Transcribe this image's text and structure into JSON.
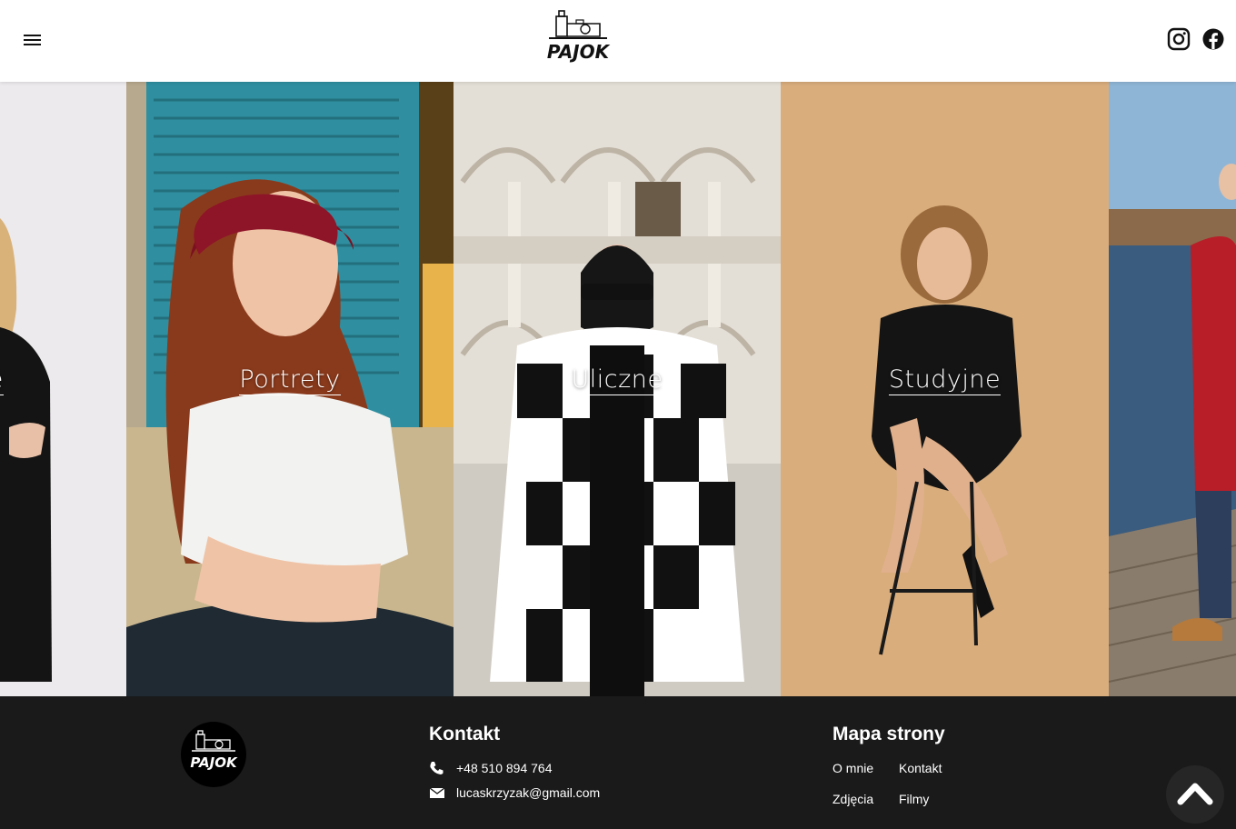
{
  "header": {
    "menu_icon": "hamburger-menu-icon",
    "logo_text": "PAJOK",
    "social": [
      {
        "name": "instagram-icon"
      },
      {
        "name": "facebook-icon"
      }
    ]
  },
  "gallery": {
    "panels": [
      {
        "label": "we"
      },
      {
        "label": "Portrety"
      },
      {
        "label": "Uliczne"
      },
      {
        "label": "Studyjne"
      },
      {
        "label": ""
      }
    ]
  },
  "footer": {
    "logo_text": "PAJOK",
    "contact": {
      "title": "Kontakt",
      "phone": "+48 510 894 764",
      "email": "lucaskrzyzak@gmail.com"
    },
    "sitemap": {
      "title": "Mapa strony",
      "links": [
        "O mnie",
        "Kontakt",
        "Zdjęcia",
        "Filmy"
      ]
    },
    "scroll_top_icon": "chevron-up-icon"
  },
  "colors": {
    "header_bg": "#ffffff",
    "footer_bg": "#1a1a1a",
    "text_light": "#ffffff"
  }
}
